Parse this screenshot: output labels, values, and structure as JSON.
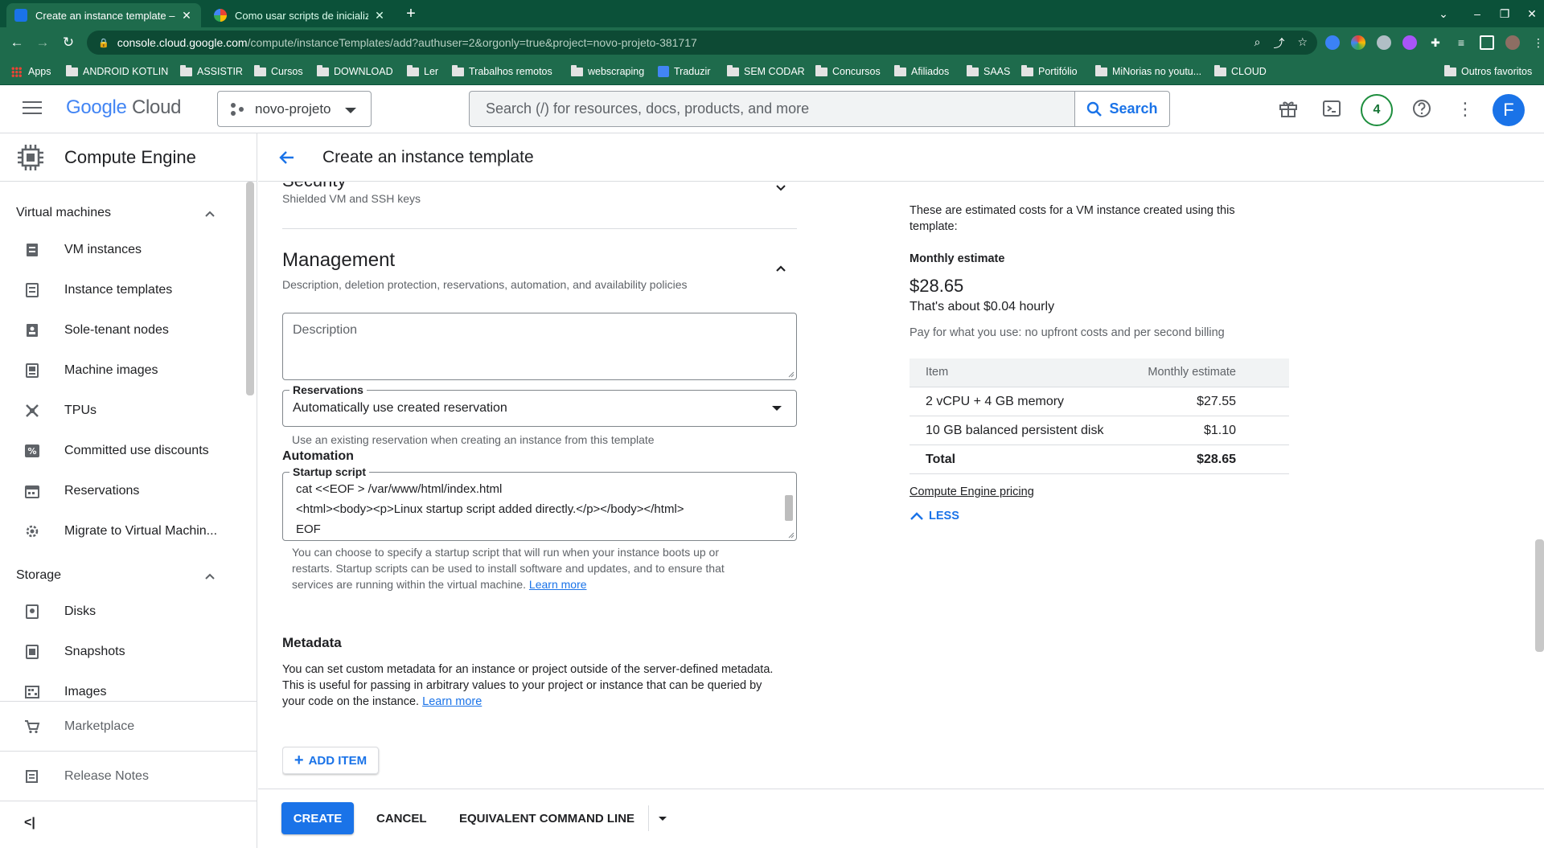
{
  "browser": {
    "tabs": [
      {
        "title": "Create an instance template – (",
        "active": true
      },
      {
        "title": "Como usar scripts de inicializaç",
        "active": false
      }
    ],
    "url_host": "console.cloud.google.com",
    "url_path": "/compute/instanceTemplates/add?authuser=2&orgonly=true&project=novo-projeto-381717",
    "bookmarks": [
      "Apps",
      "ANDROID KOTLIN",
      "ASSISTIR",
      "Cursos",
      "DOWNLOAD",
      "Ler",
      "Trabalhos remotos",
      "webscraping",
      "Traduzir",
      "SEM CODAR",
      "Concursos",
      "Afiliados",
      "SAAS",
      "Portifólio",
      "MiNorias no youtu...",
      "CLOUD"
    ],
    "other_bookmarks": "Outros favoritos"
  },
  "header": {
    "logo_google": "Google",
    "logo_cloud": "Cloud",
    "project": "novo-projeto",
    "search_placeholder": "Search (/) for resources, docs, products, and more",
    "search_button": "Search",
    "notifications_count": "4",
    "avatar_letter": "F"
  },
  "sidebar": {
    "title": "Compute Engine",
    "vm_section": "Virtual machines",
    "vm_items": [
      "VM instances",
      "Instance templates",
      "Sole-tenant nodes",
      "Machine images",
      "TPUs",
      "Committed use discounts",
      "Reservations",
      "Migrate to Virtual Machin..."
    ],
    "storage_section": "Storage",
    "storage_items": [
      "Disks",
      "Snapshots",
      "Images"
    ],
    "marketplace": "Marketplace",
    "release_notes": "Release Notes"
  },
  "page": {
    "title": "Create an instance template",
    "security_title": "Security",
    "security_sub": "Shielded VM and SSH keys",
    "management_title": "Management",
    "management_sub": "Description, deletion protection, reservations, automation, and availability policies",
    "description_placeholder": "Description",
    "reservations_label": "Reservations",
    "reservations_value": "Automatically use created reservation",
    "reservations_hint": "Use an existing reservation when creating an instance from this template",
    "automation_title": "Automation",
    "startup_label": "Startup script",
    "startup_lines": [
      "cat <<EOF > /var/www/html/index.html",
      "<html><body><p>Linux startup script added directly.</p></body></html>",
      "EOF"
    ],
    "startup_hint_1": "You can choose to specify a startup script that will run when your instance boots up or",
    "startup_hint_2": "restarts. Startup scripts can be used to install software and updates, and to ensure that",
    "startup_hint_3": "services are running within the virtual machine.",
    "learn_more": "Learn more",
    "metadata_title": "Metadata",
    "metadata_text_1": "You can set custom metadata for an instance or project outside of the server-defined metadata.",
    "metadata_text_2": "This is useful for passing in arbitrary values to your project or instance that can be queried by",
    "metadata_text_3": "your code on the instance.",
    "add_item": "ADD ITEM"
  },
  "pricing": {
    "intro_1": "These are estimated costs for a VM instance created using this",
    "intro_2": "template:",
    "monthly_label": "Monthly estimate",
    "monthly_value": "$28.65",
    "hourly": "That's about $0.04 hourly",
    "note": "Pay for what you use: no upfront costs and per second billing",
    "col_item": "Item",
    "col_estimate": "Monthly estimate",
    "rows": [
      {
        "item": "2 vCPU + 4 GB memory",
        "cost": "$27.55"
      },
      {
        "item": "10 GB balanced persistent disk",
        "cost": "$1.10"
      }
    ],
    "total_label": "Total",
    "total_value": "$28.65",
    "pricing_link": "Compute Engine pricing",
    "less": "LESS"
  },
  "actions": {
    "create": "CREATE",
    "cancel": "CANCEL",
    "equivalent": "EQUIVALENT COMMAND LINE"
  },
  "colors": {
    "browser_frame": "#1e6b4c",
    "accent": "#1a73e8"
  }
}
